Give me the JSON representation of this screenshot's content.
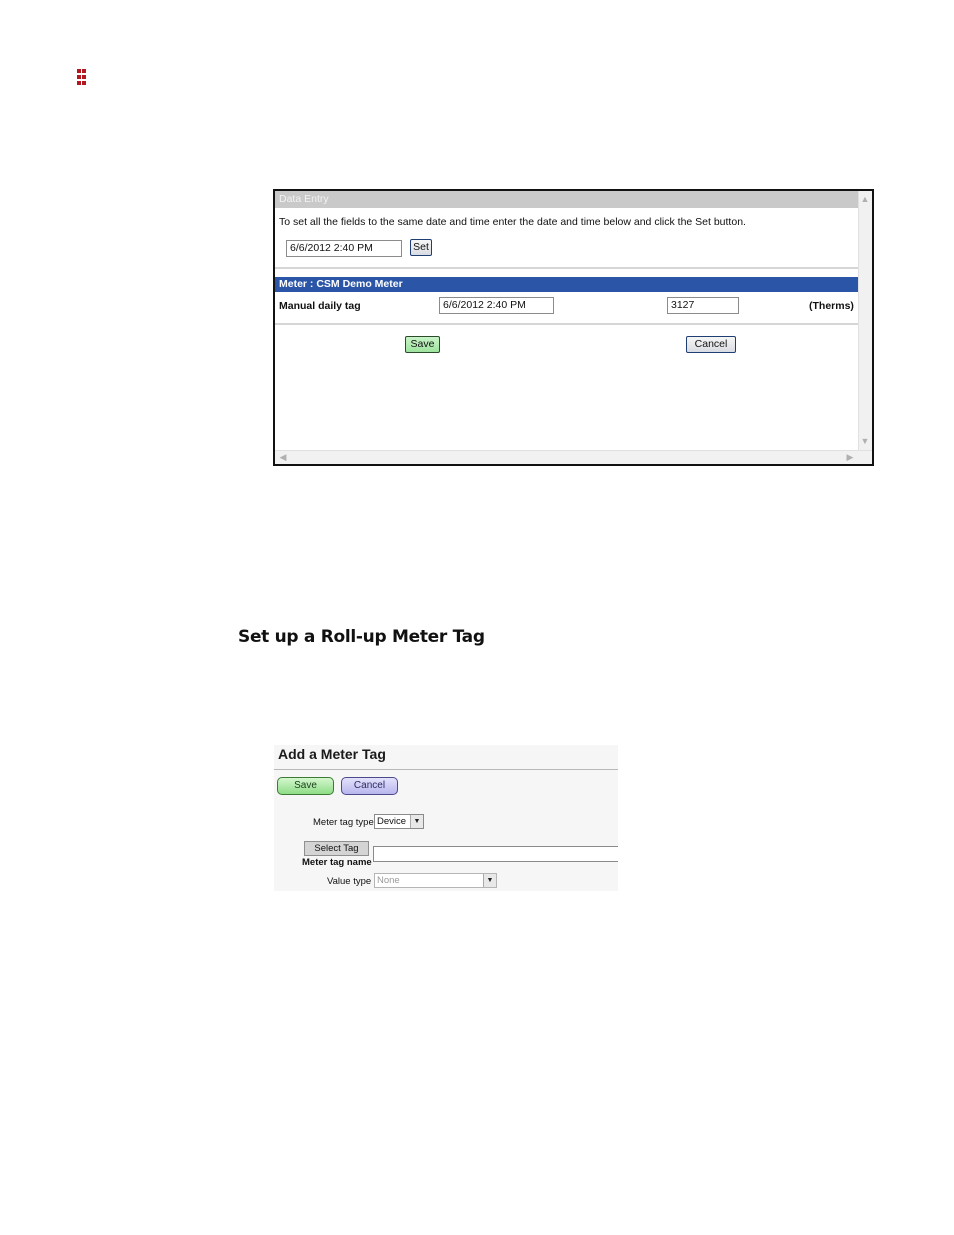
{
  "logo": {
    "name": "brand-logo",
    "color": "#b3171f"
  },
  "data_entry": {
    "header": "Data Entry",
    "instructions": "To set all the fields to the same date and time enter the date and time below and click the Set button.",
    "set_datetime_value": "6/6/2012 2:40 PM",
    "set_button": "Set",
    "meter_title": "Meter : CSM Demo Meter",
    "row": {
      "label": "Manual daily tag",
      "datetime_value": "6/6/2012 2:40 PM",
      "reading_value": "3127",
      "unit": "(Therms)"
    },
    "save_button": "Save",
    "cancel_button": "Cancel",
    "colors": {
      "header_bg": "#c9c9c9",
      "meter_bar_bg": "#2b56a8",
      "save_bg": "#a8e6a8"
    }
  },
  "section_heading": "Set up a Roll-up Meter Tag",
  "add_meter_tag": {
    "title": "Add a Meter Tag",
    "save_button": "Save",
    "cancel_button": "Cancel",
    "meter_tag_type_label": "Meter tag type",
    "meter_tag_type_value": "Device",
    "select_tag_button": "Select Tag",
    "meter_tag_name_label": "Meter tag name",
    "meter_tag_name_value": "",
    "value_type_label": "Value type",
    "value_type_value": "None"
  }
}
